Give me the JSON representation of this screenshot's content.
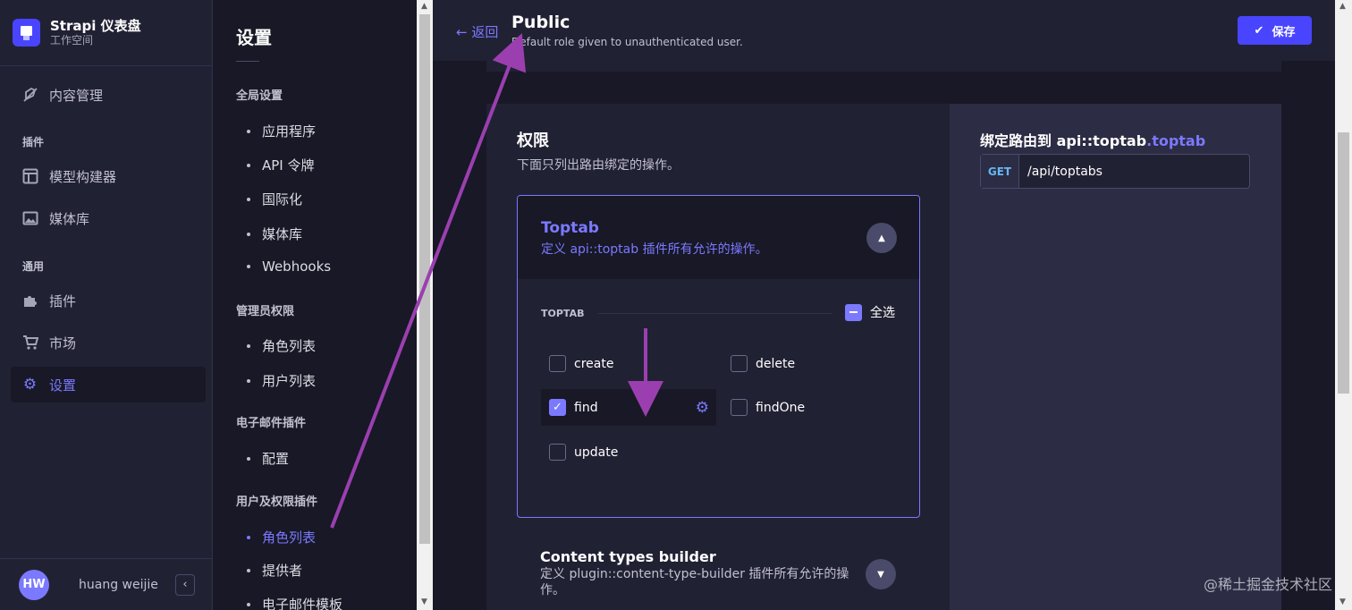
{
  "brand": {
    "title": "Strapi 仪表盘",
    "subtitle": "工作空间"
  },
  "leftnav": {
    "content_manager": "内容管理",
    "section_plugins": "插件",
    "content_type_builder": "模型构建器",
    "media_library": "媒体库",
    "section_general": "通用",
    "plugins": "插件",
    "marketplace": "市场",
    "settings": "设置"
  },
  "user": {
    "initials": "HW",
    "name": "huang weijie"
  },
  "settings_nav": {
    "title": "设置",
    "global": {
      "label": "全局设置",
      "items": [
        "应用程序",
        "API 令牌",
        "国际化",
        "媒体库",
        "Webhooks"
      ]
    },
    "admin": {
      "label": "管理员权限",
      "items": [
        "角色列表",
        "用户列表"
      ]
    },
    "email": {
      "label": "电子邮件插件",
      "items": [
        "配置"
      ]
    },
    "users_permissions": {
      "label": "用户及权限插件",
      "items": [
        "角色列表",
        "提供者",
        "电子邮件模板"
      ]
    }
  },
  "header": {
    "back": "返回",
    "title": "Public",
    "subtitle": "Default role given to unauthenticated user.",
    "save": "保存"
  },
  "permissions": {
    "title": "权限",
    "subtitle": "下面只列出路由绑定的操作。",
    "accordion": {
      "title": "Toptab",
      "subtitle": "定义 api::toptab 插件所有允许的操作。",
      "section": "TOPTAB",
      "select_all": "全选",
      "actions": [
        {
          "label": "create",
          "checked": false
        },
        {
          "label": "delete",
          "checked": false
        },
        {
          "label": "find",
          "checked": true
        },
        {
          "label": "findOne",
          "checked": false
        },
        {
          "label": "update",
          "checked": false
        }
      ]
    },
    "accordion2": {
      "title": "Content types builder",
      "subtitle": "定义 plugin::content-type-builder 插件所有允许的操作。"
    }
  },
  "route_panel": {
    "title_prefix": "绑定路由到 api::toptab",
    "title_highlight": ".toptab",
    "method": "GET",
    "path": "/api/toptabs"
  },
  "watermark": "@稀土掘金技术社区",
  "colors": {
    "accent": "#7b79ff",
    "primary": "#4945ff",
    "annotation": "#9b3fb0"
  }
}
